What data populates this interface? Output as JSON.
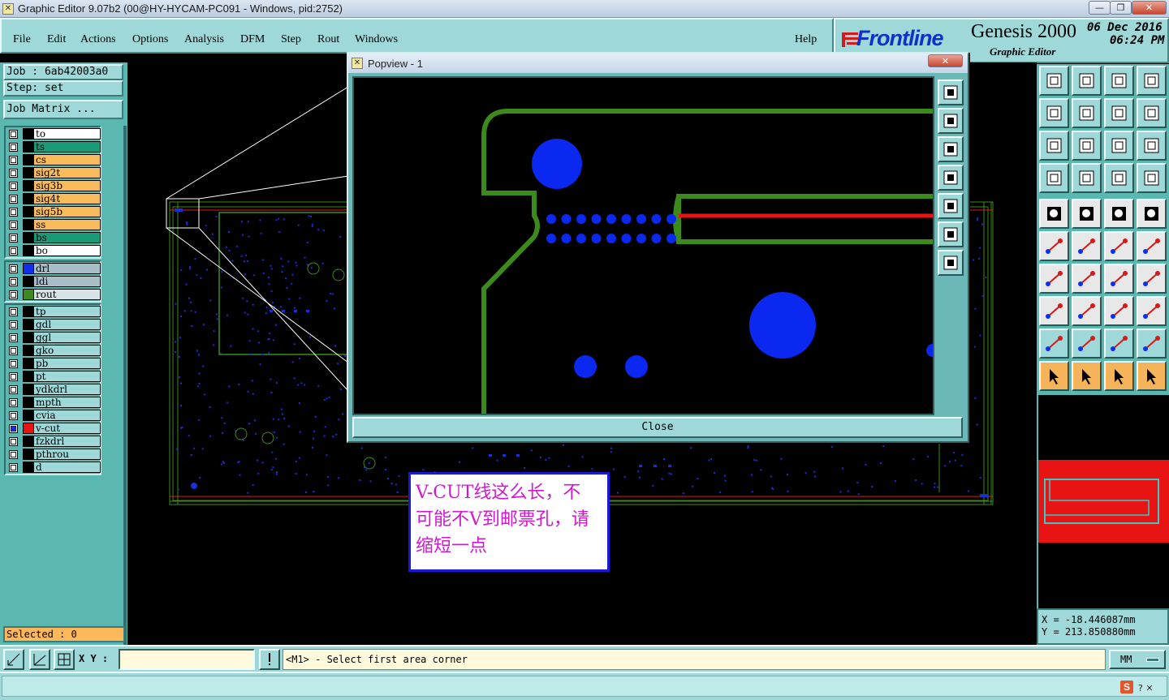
{
  "window": {
    "title": "Graphic Editor 9.07b2 (00@HY-HYCAM-PC091 - Windows, pid:2752)",
    "minimize_label": "—",
    "restore_label": "❐",
    "close_label": "✕"
  },
  "menu": {
    "items": [
      "File",
      "Edit",
      "Actions",
      "Options",
      "Analysis",
      "DFM",
      "Step",
      "Rout",
      "Windows"
    ],
    "help": "Help"
  },
  "logo": {
    "brand": "Frontline",
    "product": "Genesis 2000",
    "subtitle": "Graphic Editor",
    "date": "06 Dec 2016",
    "time": "06:24 PM"
  },
  "job": {
    "job_line": "Job  : 6ab42003a0",
    "step_line": "Step: set",
    "matrix_button": "Job Matrix ..."
  },
  "layers": {
    "group1": [
      {
        "name": "to",
        "color": "#ffffff"
      },
      {
        "name": "ts",
        "color": "#1b9a78"
      },
      {
        "name": "cs",
        "color": "#f8bc5c"
      },
      {
        "name": "sig2t",
        "color": "#f8bc5c"
      },
      {
        "name": "sig3b",
        "color": "#f8bc5c"
      },
      {
        "name": "sig4t",
        "color": "#f8bc5c"
      },
      {
        "name": "sig5b",
        "color": "#f8bc5c"
      },
      {
        "name": "ss",
        "color": "#f8bc5c"
      },
      {
        "name": "bs",
        "color": "#1b9a78"
      },
      {
        "name": "bo",
        "color": "#ffffff"
      }
    ],
    "group2": [
      {
        "name": "drl",
        "color": "#a9bfc8",
        "swatch": "#1030e8"
      },
      {
        "name": "ldi",
        "color": "#a9bfc8",
        "swatch": ""
      },
      {
        "name": "rout",
        "color": "#d8e4e8",
        "swatch": "#3c8a1c"
      }
    ],
    "group3": [
      {
        "name": "tp",
        "color": "#9ed8d8"
      },
      {
        "name": "gdl",
        "color": "#9ed8d8"
      },
      {
        "name": "ggl",
        "color": "#9ed8d8"
      },
      {
        "name": "gko",
        "color": "#9ed8d8"
      },
      {
        "name": "pb",
        "color": "#9ed8d8"
      },
      {
        "name": "pt",
        "color": "#9ed8d8"
      },
      {
        "name": "ydkdrl",
        "color": "#9ed8d8"
      },
      {
        "name": "mpth",
        "color": "#9ed8d8"
      },
      {
        "name": "cvia",
        "color": "#9ed8d8"
      },
      {
        "name": "v-cut",
        "color": "#9ed8d8",
        "swatch": "#e81414",
        "active": true
      },
      {
        "name": "fzkdrl",
        "color": "#9ed8d8"
      },
      {
        "name": "pthrou",
        "color": "#9ed8d8"
      },
      {
        "name": "d",
        "color": "#9ed8d8"
      }
    ]
  },
  "selected": "Selected : 0",
  "popview": {
    "title": "Popview - 1",
    "close_button": "Close"
  },
  "annotation": {
    "lines": [
      "V-CUT线这么长，不",
      "可能不V到邮票孔，请",
      "缩短一点"
    ]
  },
  "coords": {
    "x": "X  = -18.446087mm",
    "y": "Y  = 213.850880mm"
  },
  "bottom": {
    "xy_label": "X Y :",
    "prompt": "<M1> - Select first area corner",
    "units": "MM"
  },
  "icons": [
    "resize-icon",
    "angle-icon",
    "grid-snap-icon",
    "alert-icon",
    "zoom-in-icon",
    "zoom-out-icon"
  ]
}
